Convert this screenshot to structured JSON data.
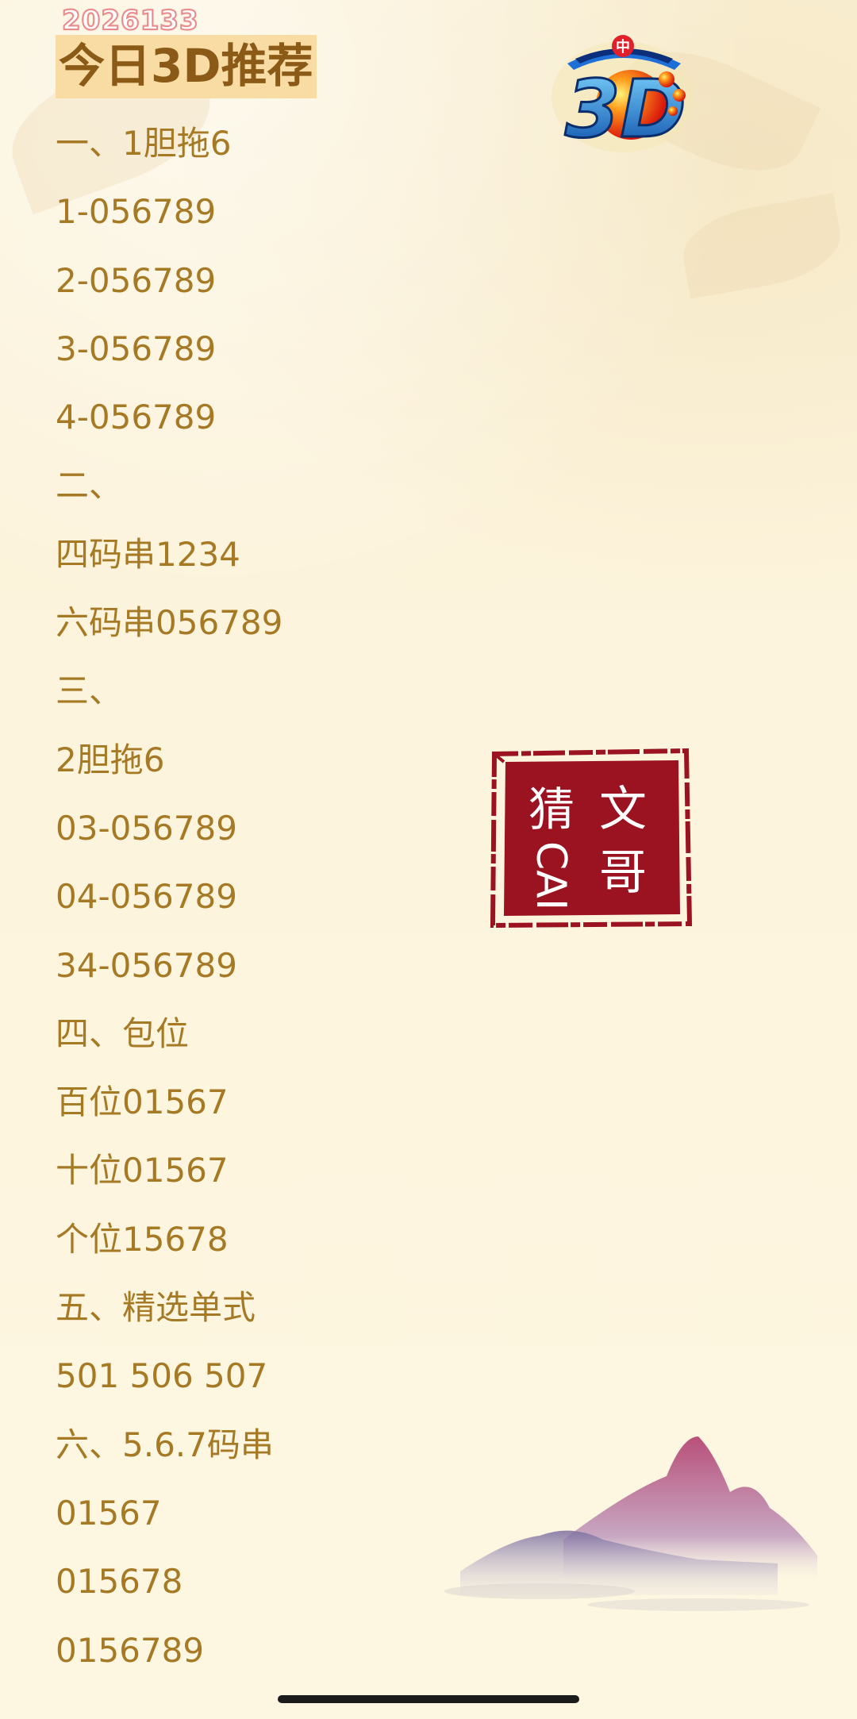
{
  "header": {
    "date_tag": "2026133",
    "title": "今日3D推荐"
  },
  "logo": {
    "text": "3D"
  },
  "seal": {
    "chars": [
      "文",
      "哥",
      "猜",
      "CAI"
    ]
  },
  "lines": [
    "一、1胆拖6",
    "1-056789",
    "2-056789",
    "3-056789",
    "4-056789",
    "二、",
    "四码串1234",
    "六码串056789",
    "三、",
    "2胆拖6",
    "03-056789",
    "04-056789",
    "34-056789",
    "四、包位",
    "百位01567",
    "十位01567",
    "个位15678",
    "五、精选单式",
    "501 506 507",
    "六、5.6.7码串",
    "01567",
    "015678",
    "0156789"
  ],
  "colors": {
    "text": "#a67925",
    "title": "#8a5a16",
    "title_bg": "#f9dca3",
    "seal": "#9b1220",
    "background": "#fcf3db"
  }
}
